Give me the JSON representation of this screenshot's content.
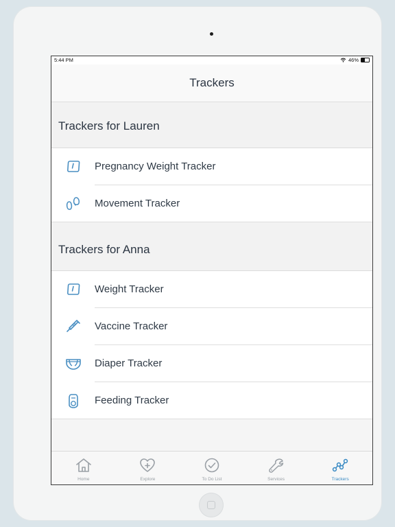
{
  "status_bar": {
    "time": "5:44 PM",
    "battery": "46%",
    "battery_level": 0.46
  },
  "nav": {
    "title": "Trackers"
  },
  "sections": [
    {
      "title": "Trackers for Lauren",
      "items": [
        {
          "label": "Pregnancy Weight Tracker",
          "icon": "scale-icon"
        },
        {
          "label": "Movement Tracker",
          "icon": "footprints-icon"
        }
      ]
    },
    {
      "title": "Trackers for Anna",
      "items": [
        {
          "label": "Weight Tracker",
          "icon": "scale-icon"
        },
        {
          "label": "Vaccine Tracker",
          "icon": "syringe-icon"
        },
        {
          "label": "Diaper Tracker",
          "icon": "diaper-icon"
        },
        {
          "label": "Feeding Tracker",
          "icon": "bottle-icon"
        }
      ]
    }
  ],
  "tabs": [
    {
      "label": "Home",
      "icon": "home-icon",
      "active": false
    },
    {
      "label": "Explore",
      "icon": "heart-plus-icon",
      "active": false
    },
    {
      "label": "To Do List",
      "icon": "check-circle-icon",
      "active": false
    },
    {
      "label": "Services",
      "icon": "wrench-icon",
      "active": false
    },
    {
      "label": "Trackers",
      "icon": "trend-line-icon",
      "active": true
    }
  ],
  "colors": {
    "accent": "#3d8cc4",
    "icon_blue": "#4a8fc2",
    "tab_inactive": "#9aa0a6",
    "text": "#2b3542"
  }
}
